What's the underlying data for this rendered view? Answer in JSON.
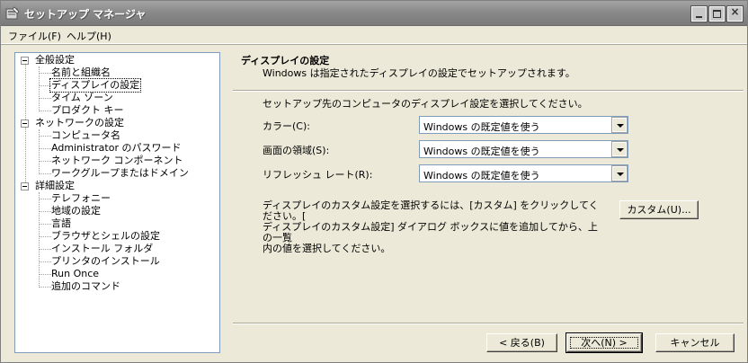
{
  "window": {
    "title": "セットアップ マネージャ",
    "controls": {
      "minimize": "minimize-icon",
      "maximize": "maximize-icon",
      "close": "×"
    }
  },
  "menu": [
    {
      "label": "ファイル(F)"
    },
    {
      "label": "ヘルプ(H)"
    }
  ],
  "tree": {
    "groups": [
      {
        "label": "全般設定",
        "children": [
          "名前と組織名",
          "ディスプレイの設定",
          "タイム ゾーン",
          "プロダクト キー"
        ]
      },
      {
        "label": "ネットワークの設定",
        "children": [
          "コンピュータ名",
          "Administrator のパスワード",
          "ネットワーク コンポーネント",
          "ワークグループまたはドメイン"
        ]
      },
      {
        "label": "詳細設定",
        "children": [
          "テレフォニー",
          "地域の設定",
          "言語",
          "ブラウザとシェルの設定",
          "インストール フォルダ",
          "プリンタのインストール",
          "Run Once",
          "追加のコマンド"
        ]
      }
    ],
    "selected": "ディスプレイの設定"
  },
  "page": {
    "title": "ディスプレイの設定",
    "description": "Windows は指定されたディスプレイの設定でセットアップされます。",
    "instruction": "セットアップ先のコンピュータのディスプレイ設定を選択してください。",
    "fields": [
      {
        "label": "カラー(C):",
        "value": "Windows の既定値を使う"
      },
      {
        "label": "画面の領域(S):",
        "value": "Windows の既定値を使う"
      },
      {
        "label": "リフレッシュ レート(R):",
        "value": "Windows の既定値を使う"
      }
    ],
    "custom_description_lines": [
      "ディスプレイのカスタム設定を選択するには、[カスタム] をクリックしてください。[",
      "ディスプレイのカスタム設定] ダイアログ ボックスに値を追加してから、上の一覧",
      "内の値を選択してください。"
    ],
    "custom_button": "カスタム(U)..."
  },
  "footer": {
    "back_button": "< 戻る(B)",
    "next_button": "次へ(N) >",
    "cancel_button": "キャンセル"
  }
}
